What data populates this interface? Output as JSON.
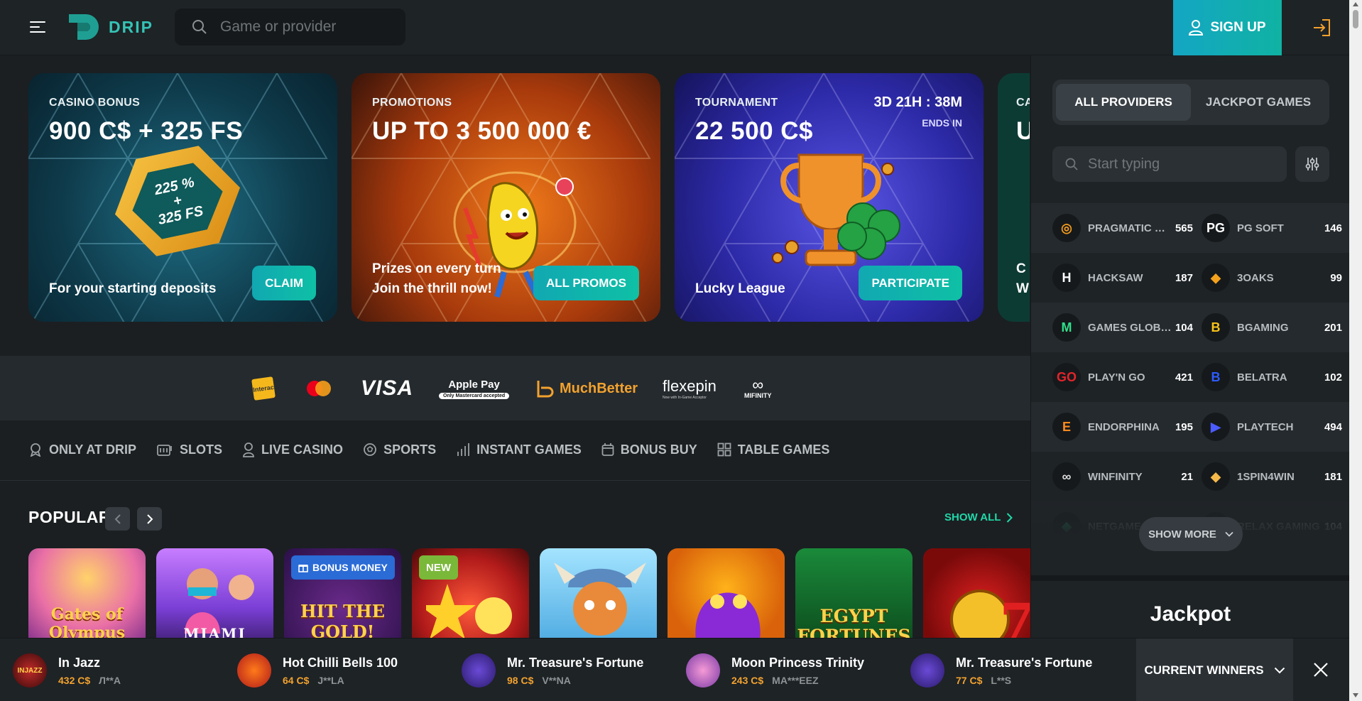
{
  "header": {
    "logo_text": "DRIP",
    "search_placeholder": "Game or provider",
    "signup_label": "SIGN UP",
    "icons": [
      "menu-icon",
      "search-icon",
      "user-icon",
      "login-icon"
    ]
  },
  "banners": [
    {
      "label": "CASINO BONUS",
      "title": "900 C$ + 325 FS",
      "art_text": "225 %\n+\n325 FS",
      "subtitle": "For your starting deposits",
      "button": "CLAIM"
    },
    {
      "label": "PROMOTIONS",
      "title": "UP TO 3 500 000 €",
      "subtitle": "Prizes on every turn\nJoin the thrill now!",
      "button": "ALL PROMOS"
    },
    {
      "label": "TOURNAMENT",
      "title": "22 500 C$",
      "subtitle": "Lucky League",
      "button": "PARTICIPATE",
      "timer": "3D 21H : 38M",
      "ends_label": "ENDS IN"
    },
    {
      "label": "CA",
      "title": "U",
      "subtitle": "C\nW"
    }
  ],
  "payments": [
    "Interac",
    "Mastercard",
    "VISA",
    "Apple Pay",
    "Only Mastercard accepted",
    "MuchBetter",
    "flexepin",
    "Now with In-Game Acceptor",
    "MIFINITY"
  ],
  "categories": [
    {
      "label": "ONLY AT DRIP",
      "icon": "badge-icon"
    },
    {
      "label": "SLOTS",
      "icon": "slot-machine-icon"
    },
    {
      "label": "LIVE CASINO",
      "icon": "live-dealer-icon"
    },
    {
      "label": "SPORTS",
      "icon": "ball-icon"
    },
    {
      "label": "INSTANT GAMES",
      "icon": "chart-bars-icon"
    },
    {
      "label": "BONUS BUY",
      "icon": "calendar-icon"
    },
    {
      "label": "TABLE GAMES",
      "icon": "grid-icon"
    }
  ],
  "popular": {
    "title": "POPULAR",
    "show_all": "SHOW ALL",
    "games": [
      {
        "art": "Gates of Olympus",
        "badge": ""
      },
      {
        "art": "MIAMI",
        "badge": ""
      },
      {
        "art": "HIT THE GOLD!",
        "badge": "BONUS MONEY"
      },
      {
        "art": "",
        "badge": "NEW"
      },
      {
        "art": "",
        "badge": ""
      },
      {
        "art": "",
        "badge": ""
      },
      {
        "art": "EGYPT FORTUNES",
        "badge": ""
      },
      {
        "art": "",
        "badge": ""
      }
    ]
  },
  "providers_panel": {
    "tab_all": "ALL PROVIDERS",
    "tab_jackpot": "JACKPOT GAMES",
    "search_placeholder": "Start typing",
    "show_more": "SHOW MORE",
    "jackpot_title": "Jackpot",
    "rows": [
      [
        {
          "name": "PRAGMATIC PLAY",
          "count": "565",
          "logo": "◎",
          "color": "#f29a1d"
        },
        {
          "name": "PG SOFT",
          "count": "146",
          "logo": "PG",
          "color": "#ffffff"
        }
      ],
      [
        {
          "name": "HACKSAW",
          "count": "187",
          "logo": "H",
          "color": "#ffffff"
        },
        {
          "name": "3OAKS",
          "count": "99",
          "logo": "◆",
          "color": "#f4a11d"
        }
      ],
      [
        {
          "name": "GAMES GLOBAL",
          "count": "104",
          "logo": "M",
          "color": "#2fe08a"
        },
        {
          "name": "BGAMING",
          "count": "201",
          "logo": "B",
          "color": "#f6c21a"
        }
      ],
      [
        {
          "name": "PLAY'N GO",
          "count": "421",
          "logo": "GO",
          "color": "#e3242b"
        },
        {
          "name": "BELATRA",
          "count": "102",
          "logo": "B",
          "color": "#2d5bff"
        }
      ],
      [
        {
          "name": "ENDORPHINA",
          "count": "195",
          "logo": "E",
          "color": "#ff8a1e"
        },
        {
          "name": "PLAYTECH",
          "count": "494",
          "logo": "▶",
          "color": "#4b5bff"
        }
      ],
      [
        {
          "name": "WINFINITY",
          "count": "21",
          "logo": "∞",
          "color": "#dddddd"
        },
        {
          "name": "1SPIN4WIN",
          "count": "181",
          "logo": "◆",
          "color": "#f5b94a"
        }
      ],
      [
        {
          "name": "NETGAME",
          "count": "",
          "logo": "◆",
          "color": "#2fe08a"
        },
        {
          "name": "RELAX GAMING",
          "count": "104",
          "logo": "R",
          "color": "#ffffff"
        }
      ]
    ]
  },
  "winners": {
    "label": "CURRENT WINNERS",
    "items": [
      {
        "game": "In Jazz",
        "amount": "432 C$",
        "user": "Л**А",
        "thumb": "INJAZZ"
      },
      {
        "game": "Hot Chilli Bells 100",
        "amount": "64 C$",
        "user": "J**LA",
        "thumb": ""
      },
      {
        "game": "Mr. Treasure's Fortune",
        "amount": "98 C$",
        "user": "V**NA",
        "thumb": ""
      },
      {
        "game": "Moon Princess Trinity",
        "amount": "243 C$",
        "user": "MA***EEZ",
        "thumb": ""
      },
      {
        "game": "Mr. Treasure's Fortune",
        "amount": "77 C$",
        "user": "L**S",
        "thumb": ""
      }
    ]
  },
  "colors": {
    "accent": "#14b7ae",
    "show_all": "#20d8a9",
    "win_amount": "#f2a22e"
  }
}
